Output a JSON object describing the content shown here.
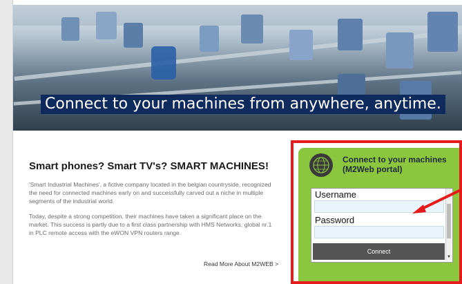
{
  "hero": {
    "title": "Connect to your machines from anywhere, anytime."
  },
  "article": {
    "heading": "Smart phones? Smart TV's? SMART MACHINES!",
    "paragraphs": [
      "'Smart Industrial Machines', a fictive company located in the belgian countryside, recognized the need for connected machines early on and successfully carved out a niche in multiple segments of the industrial world.",
      "Today, despite a strong competition, their machines have taken a significant place on the market. This success is partly due to a first class partnership with HMS Networks, global nr.1 in PLC remote access with the eWON VPN routers range."
    ],
    "read_more": "Read More About M2WEB >"
  },
  "login": {
    "title": "Connect to your machines (M2Web portal)",
    "username_label": "Username",
    "username_value": "",
    "password_label": "Password",
    "password_value": "",
    "connect_label": "Connect",
    "icon": "globe-icon"
  },
  "colors": {
    "login_bg": "#8cc63f",
    "highlight": "#e51b1b",
    "hero_title_bg": "#0f2a5c",
    "button": "#555555"
  }
}
